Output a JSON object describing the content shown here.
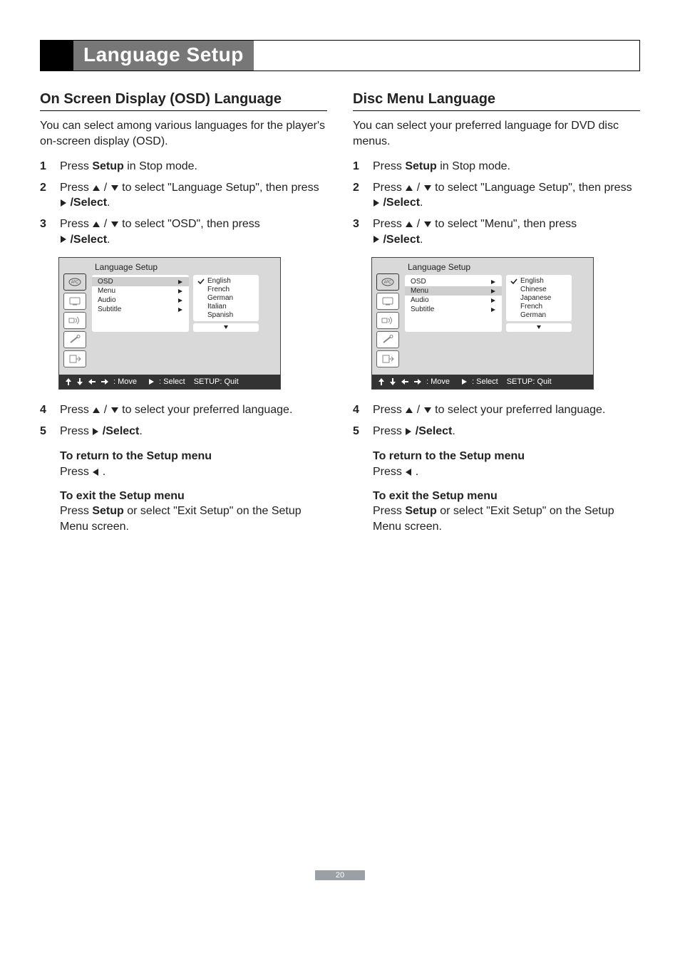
{
  "title": "Language Setup",
  "left": {
    "heading": "On Screen Display (OSD) Language",
    "intro": "You can select among various languages for the player's on-screen display (OSD).",
    "steps": {
      "s1_a": "Press ",
      "s1_b": "Setup",
      "s1_c": " in Stop mode.",
      "s2_a": "Press ",
      "s2_b": " to select \"Language Setup\", then press ",
      "s2_c": "/Select",
      "s2_d": ".",
      "s3_a": "Press ",
      "s3_b": " to select \"OSD\", then press ",
      "s3_c": "/Select",
      "s3_d": ".",
      "s4_a": "Press ",
      "s4_b": " to select your preferred language.",
      "s5_a": "Press ",
      "s5_b": "/Select",
      "s5_c": "."
    },
    "osd": {
      "title": "Language  Setup",
      "menu": {
        "m1": "OSD",
        "m2": "Menu",
        "m3": "Audio",
        "m4": "Subtitle"
      },
      "langs": {
        "l1": "English",
        "l2": "French",
        "l3": "German",
        "l4": "Italian",
        "l5": "Spanish"
      },
      "footer_move": ": Move",
      "footer_select": ": Select",
      "footer_quit": "SETUP: Quit",
      "highlight": "m1"
    },
    "return": {
      "hdr": "To return to the Setup menu",
      "body_a": "Press ",
      "body_b": " ."
    },
    "exit": {
      "hdr": "To exit the Setup menu",
      "body_a": "Press ",
      "body_b": "Setup",
      "body_c": " or select \"Exit Setup\" on the Setup Menu screen."
    }
  },
  "right": {
    "heading": "Disc Menu Language",
    "intro": "You can select your preferred language for DVD disc menus.",
    "steps": {
      "s1_a": "Press ",
      "s1_b": "Setup",
      "s1_c": " in Stop mode.",
      "s2_a": "Press ",
      "s2_b": " to select \"Language Setup\", then press ",
      "s2_c": "/Select",
      "s2_d": ".",
      "s3_a": "Press ",
      "s3_b": " to select \"Menu\", then press ",
      "s3_c": "/Select",
      "s3_d": ".",
      "s4_a": "Press ",
      "s4_b": " to select your preferred language.",
      "s5_a": "Press ",
      "s5_b": "/Select",
      "s5_c": "."
    },
    "osd": {
      "title": "Language  Setup",
      "menu": {
        "m1": "OSD",
        "m2": "Menu",
        "m3": "Audio",
        "m4": "Subtitle"
      },
      "langs": {
        "l1": "English",
        "l2": "Chinese",
        "l3": "Japanese",
        "l4": "French",
        "l5": "German"
      },
      "footer_move": ": Move",
      "footer_select": ": Select",
      "footer_quit": "SETUP: Quit",
      "highlight": "m2"
    },
    "return": {
      "hdr": "To return to the Setup menu",
      "body_a": "Press ",
      "body_b": " ."
    },
    "exit": {
      "hdr": "To exit the Setup menu",
      "body_a": "Press ",
      "body_b": "Setup",
      "body_c": " or select \"Exit Setup\" on the Setup Menu screen."
    }
  },
  "page_number": "20"
}
